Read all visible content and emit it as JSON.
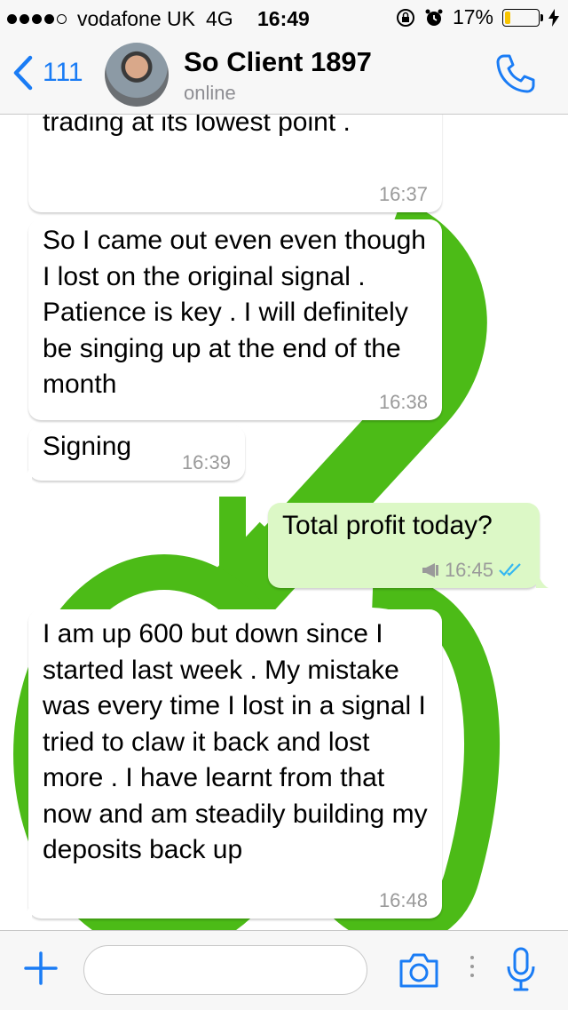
{
  "status_bar": {
    "carrier": "vodafone UK",
    "network": "4G",
    "time": "16:49",
    "battery": "17%",
    "battery_level": 0.17
  },
  "header": {
    "back_count": "111",
    "contact_name": "So Client 1897",
    "contact_status": "online"
  },
  "messages": [
    {
      "direction": "in",
      "text": "up I then pulled a load back by trading at its lowest point .",
      "time": "16:37"
    },
    {
      "direction": "in",
      "text": "So I came out even even though I lost on the original signal . Patience is key . I will definitely be singing up at the end of the month",
      "time": "16:38"
    },
    {
      "direction": "in",
      "text": "Signing",
      "time": "16:39"
    },
    {
      "direction": "out",
      "text": "Total profit today?",
      "time": "16:45",
      "status": "read"
    },
    {
      "direction": "in",
      "text": "I am up 600 but down since I started last week . My mistake was every time I lost in a signal I tried to claw it back and lost more . I have learnt from that now and am steadily building my deposits back up",
      "time": "16:48"
    }
  ],
  "icons": {
    "back": "chevron-left-icon",
    "call": "phone-icon",
    "add": "plus-icon",
    "camera": "camera-icon",
    "mic": "microphone-icon",
    "read_receipt": "double-check-icon",
    "broadcast": "megaphone-icon"
  },
  "colors": {
    "accent": "#1a7cf5",
    "outgoing_bubble": "#dcf8c6",
    "read_ticks": "#34b7f1",
    "wallpaper_green": "#4cbb17"
  }
}
